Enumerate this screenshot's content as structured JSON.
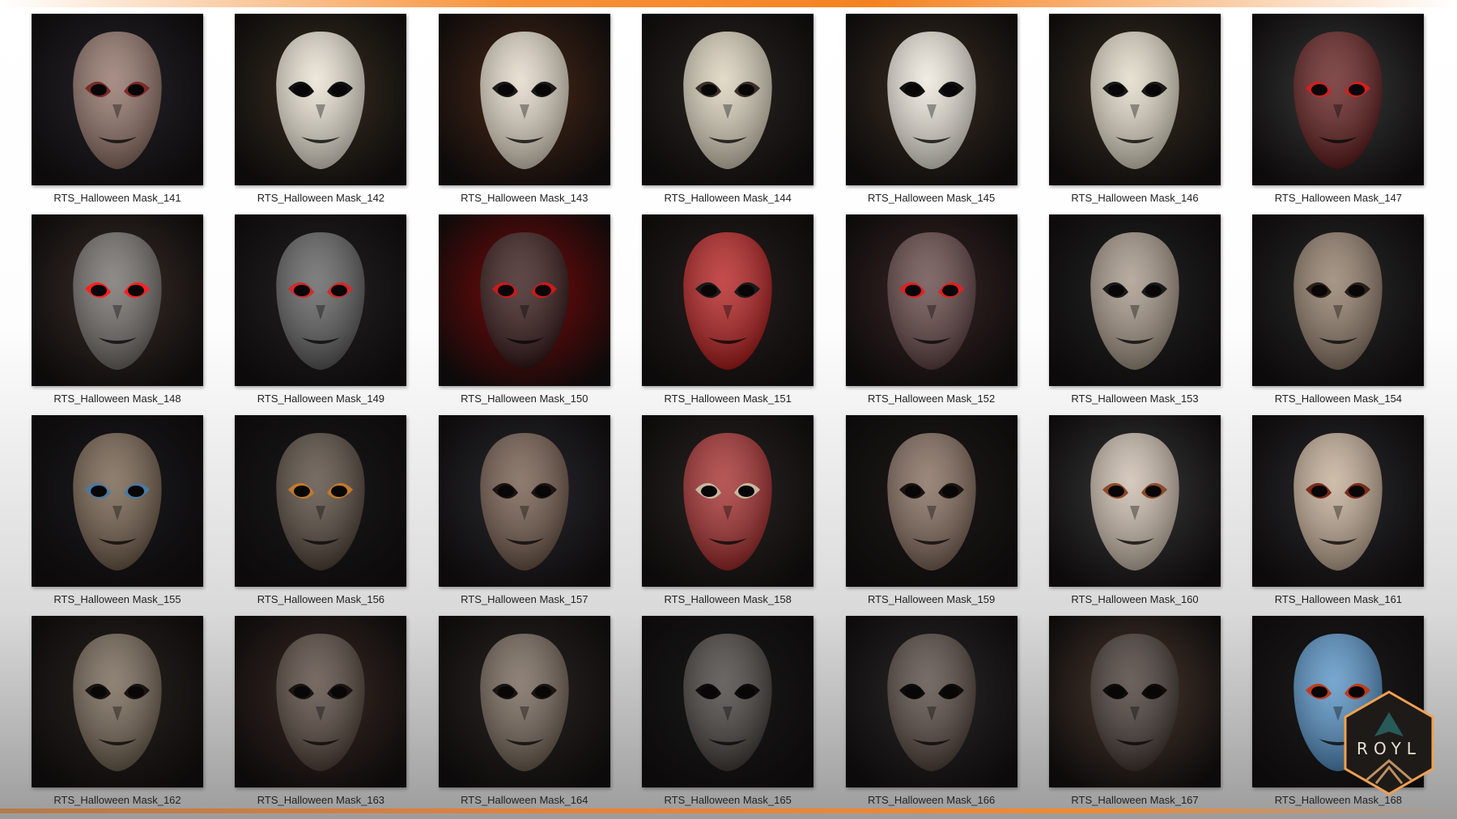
{
  "tiles": [
    {
      "label": "RTS_Halloween Mask_141",
      "bg": "#26242a",
      "face": "#8a6a5e",
      "accent": "#7a2a2a"
    },
    {
      "label": "RTS_Halloween Mask_142",
      "bg": "#3a3022",
      "face": "#e8e0d0",
      "accent": "#111111"
    },
    {
      "label": "RTS_Halloween Mask_143",
      "bg": "#4a2a1a",
      "face": "#e0d6c4",
      "accent": "#1a1a1a"
    },
    {
      "label": "RTS_Halloween Mask_144",
      "bg": "#2a2622",
      "face": "#d8cfb8",
      "accent": "#3a3028"
    },
    {
      "label": "RTS_Halloween Mask_145",
      "bg": "#3a2e24",
      "face": "#ece6da",
      "accent": "#111111"
    },
    {
      "label": "RTS_Halloween Mask_146",
      "bg": "#3a3024",
      "face": "#e0d8c4",
      "accent": "#1a1a1a"
    },
    {
      "label": "RTS_Halloween Mask_147",
      "bg": "#3a3a3a",
      "face": "#5a1010",
      "accent": "#d02020"
    },
    {
      "label": "RTS_Halloween Mask_148",
      "bg": "#3a2e28",
      "face": "#6a6460",
      "accent": "#ff2020"
    },
    {
      "label": "RTS_Halloween Mask_149",
      "bg": "#242222",
      "face": "#555555",
      "accent": "#d02a2a"
    },
    {
      "label": "RTS_Halloween Mask_150",
      "bg": "#7a0a0a",
      "face": "#2a0a0a",
      "accent": "#d01818"
    },
    {
      "label": "RTS_Halloween Mask_151",
      "bg": "#2a2020",
      "face": "#b01010",
      "accent": "#1a1a1a"
    },
    {
      "label": "RTS_Halloween Mask_152",
      "bg": "#3a2626",
      "face": "#5a3a3a",
      "accent": "#e02020"
    },
    {
      "label": "RTS_Halloween Mask_153",
      "bg": "#242424",
      "face": "#a09080",
      "accent": "#1a1a1a"
    },
    {
      "label": "RTS_Halloween Mask_154",
      "bg": "#2a2a2a",
      "face": "#8a7460",
      "accent": "#2a2018"
    },
    {
      "label": "RTS_Halloween Mask_155",
      "bg": "#1a1a1e",
      "face": "#6a5440",
      "accent": "#4a7aa0"
    },
    {
      "label": "RTS_Halloween Mask_156",
      "bg": "#1a1a1a",
      "face": "#4a3c30",
      "accent": "#c07a2a"
    },
    {
      "label": "RTS_Halloween Mask_157",
      "bg": "#2a2a30",
      "face": "#6a5040",
      "accent": "#1a1412"
    },
    {
      "label": "RTS_Halloween Mask_158",
      "bg": "#2a2624",
      "face": "#a02020",
      "accent": "#c8b8a0"
    },
    {
      "label": "RTS_Halloween Mask_159",
      "bg": "#1e1a1a",
      "face": "#7a6050",
      "accent": "#1a1412"
    },
    {
      "label": "RTS_Halloween Mask_160",
      "bg": "#3a3a3a",
      "face": "#c8b8a8",
      "accent": "#8a4a2a"
    },
    {
      "label": "RTS_Halloween Mask_161",
      "bg": "#2a2a2e",
      "face": "#c0a890",
      "accent": "#7a2a1a"
    },
    {
      "label": "RTS_Halloween Mask_162",
      "bg": "#2a2420",
      "face": "#6a5a48",
      "accent": "#1a1412"
    },
    {
      "label": "RTS_Halloween Mask_163",
      "bg": "#3a2a24",
      "face": "#4a3a30",
      "accent": "#1a1412"
    },
    {
      "label": "RTS_Halloween Mask_164",
      "bg": "#2a2624",
      "face": "#6a5a4c",
      "accent": "#1a1412"
    },
    {
      "label": "RTS_Halloween Mask_165",
      "bg": "#1a1a1a",
      "face": "#3a3430",
      "accent": "#0e0c0a"
    },
    {
      "label": "RTS_Halloween Mask_166",
      "bg": "#2a2828",
      "face": "#4a3c34",
      "accent": "#0e0c0a"
    },
    {
      "label": "RTS_Halloween Mask_167",
      "bg": "#4a3a30",
      "face": "#3a2e28",
      "accent": "#0e0c0a"
    },
    {
      "label": "RTS_Halloween Mask_168",
      "bg": "#1e1c1c",
      "face": "#4a8ac0",
      "accent": "#c03a1a"
    }
  ],
  "logo": {
    "text": "ROYL",
    "border": "#f0a050",
    "fill": "#1e1a18"
  }
}
